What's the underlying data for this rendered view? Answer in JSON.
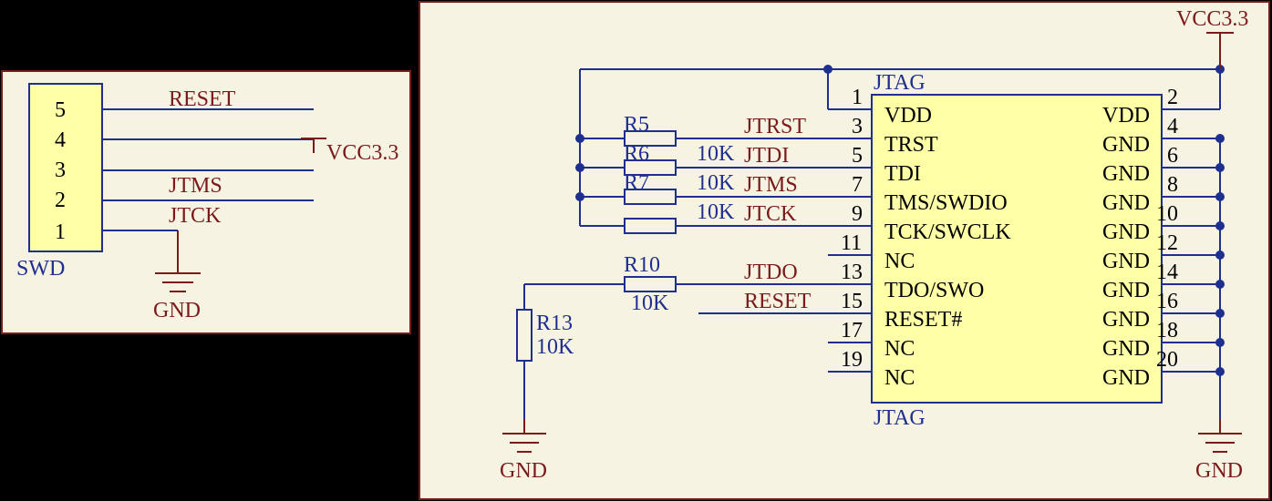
{
  "power": {
    "vcc": "VCC3.3",
    "gnd": "GND"
  },
  "swd": {
    "name": "SWD",
    "pins": {
      "1": {
        "net": "GND"
      },
      "2": {
        "net": "JTCK"
      },
      "3": {
        "net": "JTMS"
      },
      "4": {
        "net": "VCC3.3"
      },
      "5": {
        "net": "RESET"
      }
    }
  },
  "jtag": {
    "title": "JTAG",
    "designator": "JTAG",
    "pins_left": [
      {
        "num": "1",
        "name": "VDD"
      },
      {
        "num": "3",
        "name": "TRST"
      },
      {
        "num": "5",
        "name": "TDI"
      },
      {
        "num": "7",
        "name": "TMS/SWDIO"
      },
      {
        "num": "9",
        "name": "TCK/SWCLK"
      },
      {
        "num": "11",
        "name": "NC"
      },
      {
        "num": "13",
        "name": "TDO/SWO"
      },
      {
        "num": "15",
        "name": "RESET#"
      },
      {
        "num": "17",
        "name": "NC"
      },
      {
        "num": "19",
        "name": "NC"
      }
    ],
    "pins_right": [
      {
        "num": "2",
        "name": "VDD"
      },
      {
        "num": "4",
        "name": "GND"
      },
      {
        "num": "6",
        "name": "GND"
      },
      {
        "num": "8",
        "name": "GND"
      },
      {
        "num": "10",
        "name": "GND"
      },
      {
        "num": "12",
        "name": "GND"
      },
      {
        "num": "14",
        "name": "GND"
      },
      {
        "num": "16",
        "name": "GND"
      },
      {
        "num": "18",
        "name": "GND"
      },
      {
        "num": "20",
        "name": "GND"
      }
    ],
    "nets_left": {
      "3": "JTRST",
      "5": "JTDI",
      "7": "JTMS",
      "9": "JTCK",
      "13": "JTDO",
      "15": "RESET"
    }
  },
  "resistors": {
    "r5": {
      "ref": "R5",
      "value": ""
    },
    "r6": {
      "ref": "R6",
      "value": "10K"
    },
    "r7": {
      "ref": "R7",
      "value": "10K"
    },
    "r7b": {
      "ref": "",
      "value": "10K"
    },
    "r10": {
      "ref": "R10",
      "value": "10K"
    },
    "r13": {
      "ref": "R13",
      "value": "10K"
    }
  }
}
